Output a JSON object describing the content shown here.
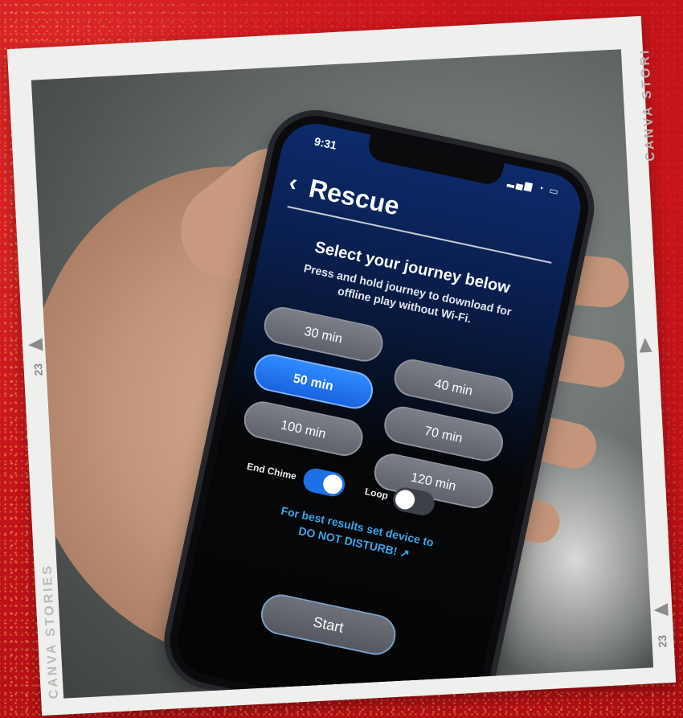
{
  "frame": {
    "watermark_top": "CANVA STORI",
    "watermark_bottom": "CANVA STORIES",
    "film_number_left": "23",
    "film_number_right": "23"
  },
  "app": {
    "status_time": "9:31",
    "status_icons": "signal-wifi-battery",
    "back_icon": "chevron-left-icon",
    "title": "Rescue",
    "heading": "Select your journey below",
    "subheading": "Press and hold journey to download for offline play without Wi-Fi.",
    "durations": [
      {
        "label": "30 min",
        "selected": false
      },
      {
        "label": "40 min",
        "selected": false
      },
      {
        "label": "50 min",
        "selected": true
      },
      {
        "label": "70 min",
        "selected": false
      },
      {
        "label": "100 min",
        "selected": false
      },
      {
        "label": "120 min",
        "selected": false
      }
    ],
    "end_chime": {
      "label": "End Chime",
      "on": true
    },
    "loop": {
      "label": "Loop",
      "on": false
    },
    "note_line1": "For best results set device to",
    "note_line2": "DO NOT DISTURB!",
    "note_icon": "external-link-icon",
    "start_label": "Start",
    "accent_color": "#1f6fe6",
    "note_color": "#3fa6e6"
  }
}
